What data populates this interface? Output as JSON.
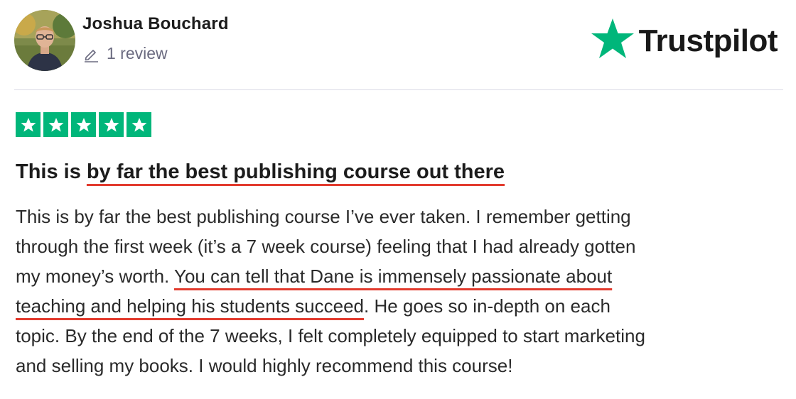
{
  "reviewer": {
    "name": "Joshua Bouchard",
    "review_count": "1 review"
  },
  "brand": {
    "name": "Trustpilot",
    "star_color": "#00b67a"
  },
  "rating": {
    "stars": 5,
    "max": 5,
    "color": "#00b67a"
  },
  "review": {
    "title_plain": "This is ",
    "title_highlight": "by far the best publishing course out there",
    "lines": [
      {
        "plain_before": "This is by far the best publishing course I’ve ever taken. I remember getting",
        "highlight": "",
        "plain_after": ""
      },
      {
        "plain_before": "through the first week (it’s a 7 week course) feeling that I had already gotten",
        "highlight": "",
        "plain_after": ""
      },
      {
        "plain_before": "my money’s worth. ",
        "highlight": "You can tell that Dane is immensely passionate about",
        "plain_after": ""
      },
      {
        "plain_before": "",
        "highlight": "teaching and helping his students succeed",
        "plain_after": ". He goes so in-depth on each"
      },
      {
        "plain_before": "topic. By the end of the 7 weeks, I felt completely equipped to start marketing",
        "highlight": "",
        "plain_after": ""
      },
      {
        "plain_before": "and selling my books. I would highly recommend this course!",
        "highlight": "",
        "plain_after": ""
      }
    ],
    "underline_color": "#e23b2e"
  },
  "icons": {
    "edit": "pencil-icon",
    "brand_star": "trustpilot-star-icon",
    "rating_star": "star-icon"
  }
}
